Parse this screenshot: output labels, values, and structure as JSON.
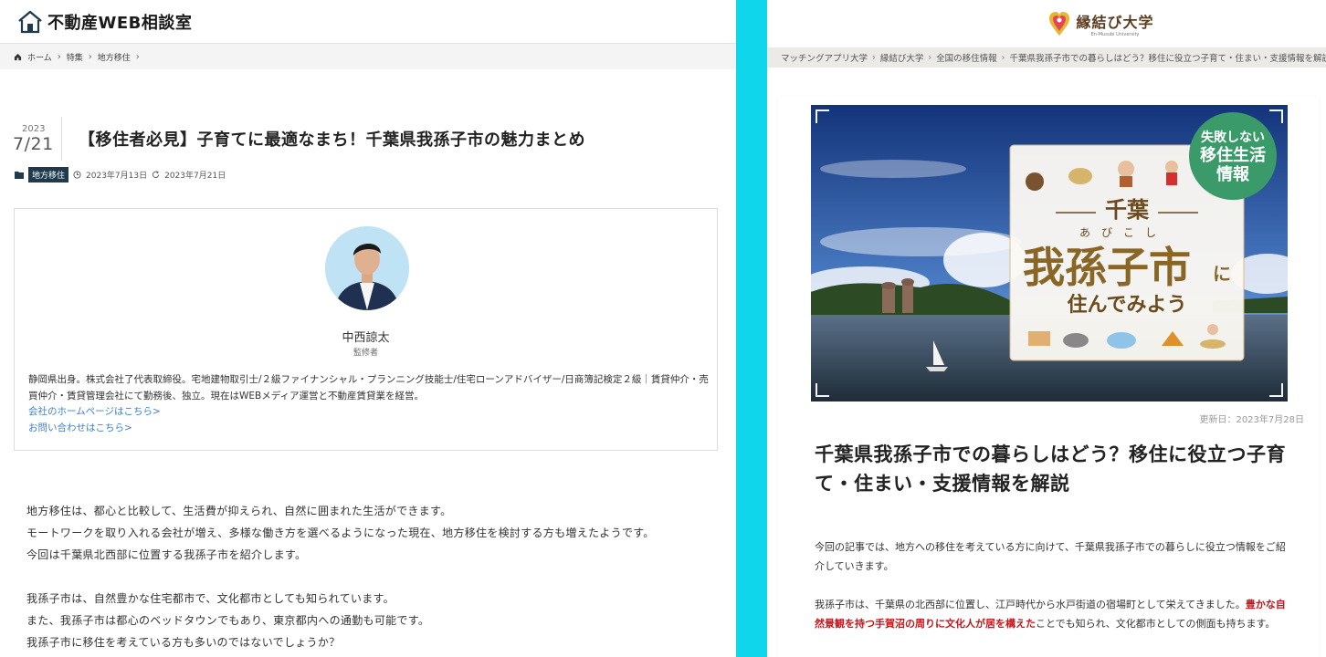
{
  "left": {
    "site_name": "不動産WEB相談室",
    "breadcrumb": [
      "ホーム",
      "特集",
      "地方移住"
    ],
    "date_year": "2023",
    "date_md": "7/21",
    "title": "【移住者必見】子育てに最適なまち！千葉県我孫子市の魅力まとめ",
    "category": "地方移住",
    "published": "2023年7月13日",
    "modified": "2023年7月21日",
    "author": {
      "name": "中西諒太",
      "role": "監修者",
      "bio": "静岡県出身。株式会社了代表取締役。宅地建物取引士/２級ファイナンシャル・プランニング技能士/住宅ローンアドバイザー/日商簿記検定２級｜賃貸仲介・売買仲介・賃貸管理会社にて勤務後、独立。現在はWEBメディア運営と不動産賃貸業を経営。",
      "link_home": "会社のホームページはこちら>",
      "link_contact": "お問い合わせはこちら>"
    },
    "paragraphs": [
      [
        "地方移住は、都心と比較して、生活費が抑えられ、自然に囲まれた生活ができます。",
        "モートワークを取り入れる会社が増え、多様な働き方を選べるようになった現在、地方移住を検討する方も増えたようです。",
        "今回は千葉県北西部に位置する我孫子市を紹介します。"
      ],
      [
        "我孫子市は、自然豊かな住宅都市で、文化都市としても知られています。",
        "また、我孫子市は都心のベッドタウンでもあり、東京都内への通勤も可能です。",
        "我孫子市に移住を考えている方も多いのではないでしょうか？"
      ]
    ]
  },
  "right": {
    "logo_main": "縁結び大学",
    "logo_sub": "En-Musubi University",
    "breadcrumb": [
      "マッチングアプリ大学",
      "縁結び大学",
      "全国の移住情報",
      "千葉県我孫子市での暮らしはどう？移住に役立つ子育て・住まい・支援情報を解説"
    ],
    "hero": {
      "badge_line1": "失敗しない",
      "badge_line2": "移住生活",
      "badge_line3": "情報",
      "prefecture": "千葉",
      "furigana": "あ　び　こ　し",
      "city": "我孫子市",
      "city_suffix": "に",
      "tagline": "住んでみよう"
    },
    "updated": "更新日：2023年7月28日",
    "title": "千葉県我孫子市での暮らしはどう？移住に役立つ子育て・住まい・支援情報を解説",
    "intro": "今回の記事では、地方への移住を考えている方に向けて、千葉県我孫子市での暮らしに役立つ情報をご紹介していきます。",
    "para2_a": "我孫子市は、千葉県の北西部に位置し、江戸時代から水戸街道の宿場町として栄えてきました。",
    "para2_red": "豊かな自然景観を持つ手賀沼の周りに文化人が居を構えた",
    "para2_b": "ことでも知られ、文化都市としての側面も持ちます。"
  }
}
